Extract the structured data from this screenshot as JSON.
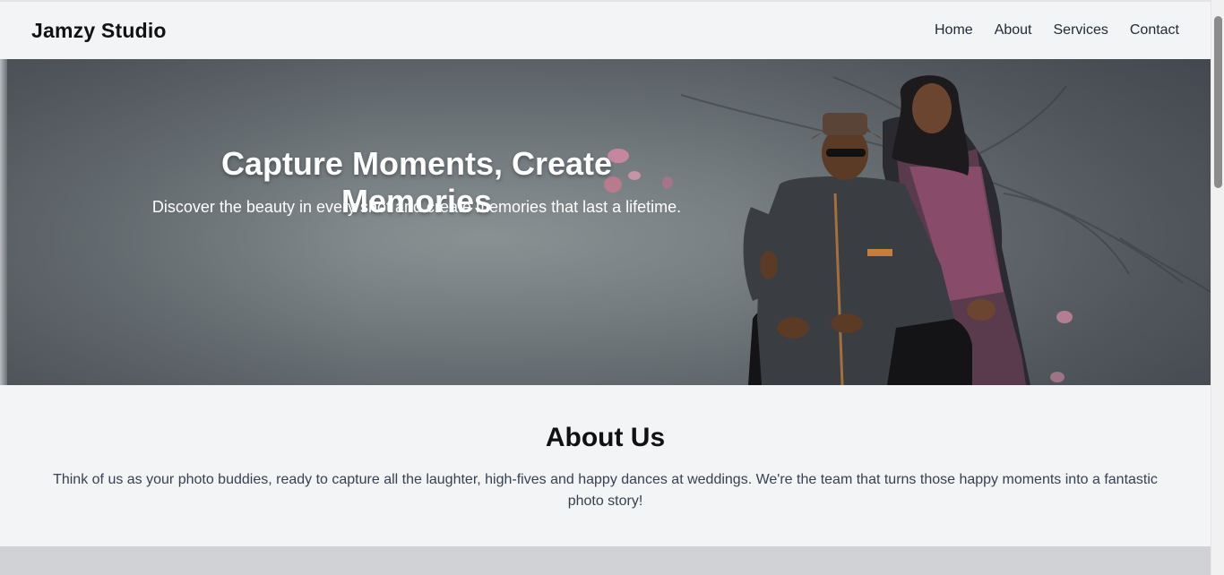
{
  "header": {
    "brand": "Jamzy Studio",
    "nav": [
      "Home",
      "About",
      "Services",
      "Contact"
    ]
  },
  "hero": {
    "title": "Capture Moments, Create Memories",
    "subtitle": "Discover the beauty in every shot and create memories that last a lifetime.",
    "image_subject": "portrait-couple-photo"
  },
  "about": {
    "title": "About Us",
    "text": "Think of us as your photo buddies, ready to capture all the laughter, high-fives and happy dances at weddings. We're the team that turns those happy moments into a fantastic photo story!"
  },
  "colors": {
    "page_bg": "#f3f4f6",
    "hero_bg": "#6e7579",
    "footer_band": "#d1d2d6",
    "text_dark": "#111111"
  }
}
